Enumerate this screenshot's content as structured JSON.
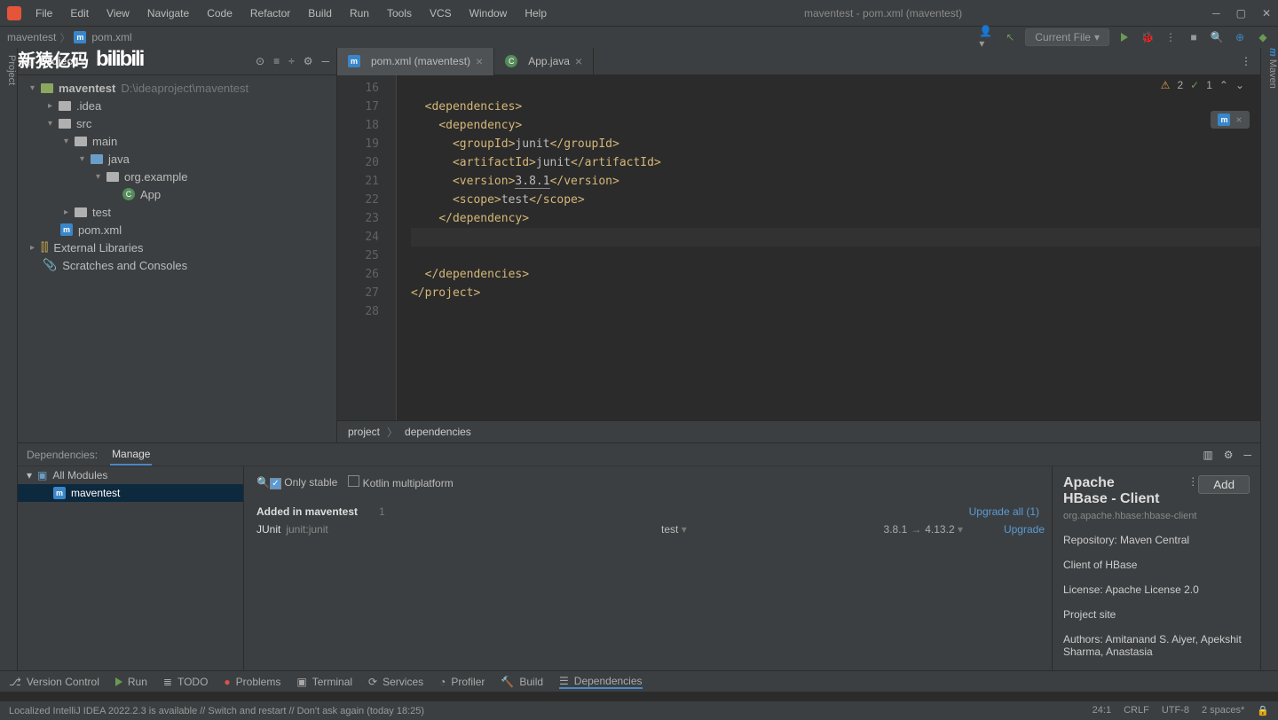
{
  "menu": {
    "file": "File",
    "edit": "Edit",
    "view": "View",
    "navigate": "Navigate",
    "code": "Code",
    "refactor": "Refactor",
    "build": "Build",
    "run": "Run",
    "tools": "Tools",
    "vcs": "VCS",
    "window": "Window",
    "help": "Help"
  },
  "title": "maventest - pom.xml (maventest)",
  "crumb": {
    "project": "maventest",
    "file": "pom.xml"
  },
  "toolbar": {
    "config": "Current File"
  },
  "sidebar": {
    "title": "Project",
    "root": "maventest",
    "rootPath": "D:\\ideaproject\\maventest",
    "idea": ".idea",
    "src": "src",
    "mainf": "main",
    "java": "java",
    "pkg": "org.example",
    "cls": "App",
    "test": "test",
    "pom": "pom.xml",
    "ext": "External Libraries",
    "scratch": "Scratches and Consoles"
  },
  "tabs": {
    "pom": "pom.xml (maventest)",
    "app": "App.java"
  },
  "lineStart": 16,
  "code": {
    "l17": "<dependencies>",
    "l18": "<dependency>",
    "l19a": "<groupId>",
    "l19b": "junit",
    "l19c": "</groupId>",
    "l20a": "<artifactId>",
    "l20b": "junit",
    "l20c": "</artifactId>",
    "l21a": "<version>",
    "l21b": "3.8.1",
    "l21c": "</version>",
    "l22a": "<scope>",
    "l22b": "test",
    "l22c": "</scope>",
    "l23": "</dependency>",
    "l26": "</dependencies>",
    "l27": "</project>"
  },
  "inspect": {
    "warn": "2",
    "ok": "1"
  },
  "bcrumb": {
    "a": "project",
    "b": "dependencies"
  },
  "dep": {
    "label": "Dependencies:",
    "manage": "Manage",
    "allmods": "All Modules",
    "mod": "maventest",
    "onlystable": "Only stable",
    "kotlin": "Kotlin multiplatform",
    "addedIn": "Added in maventest",
    "count": "1",
    "name": "JUnit",
    "coord": "junit:junit",
    "scope": "test",
    "from": "3.8.1",
    "to": "4.13.2",
    "upgradeAll": "Upgrade all (1)",
    "upgrade": "Upgrade",
    "rtitle1": "Apache",
    "rtitle2": "HBase - Client",
    "rcoord": "org.apache.hbase:hbase-client",
    "repo": "Repository: Maven Central",
    "desc": "Client of HBase",
    "license": "License: Apache License 2.0",
    "site": "Project site",
    "authors": "Authors: Amitanand S. Aiyer, Apekshit Sharma, Anastasia",
    "add": "Add"
  },
  "bottom": {
    "vc": "Version Control",
    "run": "Run",
    "todo": "TODO",
    "problems": "Problems",
    "terminal": "Terminal",
    "services": "Services",
    "profiler": "Profiler",
    "build": "Build",
    "deps": "Dependencies"
  },
  "status": {
    "msg": "Localized IntelliJ IDEA 2022.2.3 is available // Switch and restart // Don't ask again (today 18:25)",
    "pos": "24:1",
    "eol": "CRLF",
    "enc": "UTF-8",
    "ind": "2 spaces*"
  },
  "watermark": "新猿亿码",
  "bili": "bilibili",
  "leftGutter": "Project",
  "rightGutter": "Maven"
}
